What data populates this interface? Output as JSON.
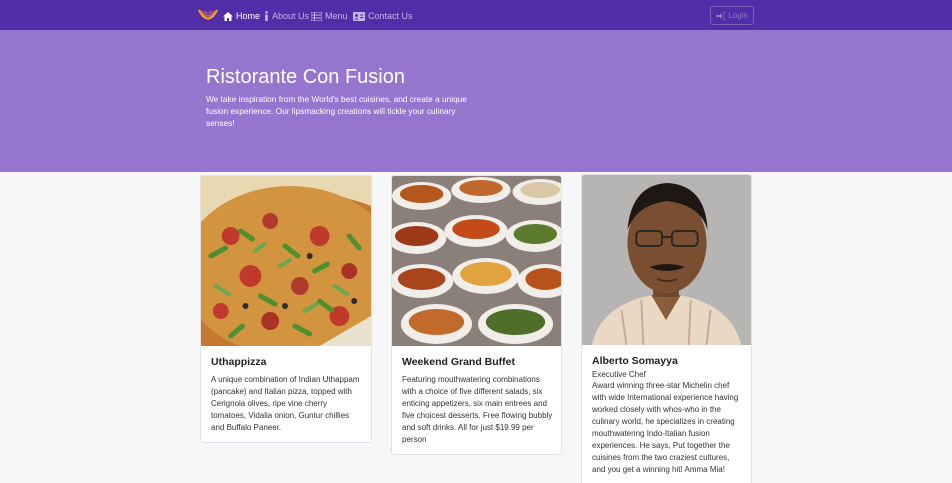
{
  "navbar": {
    "logo": "restaurant-logo",
    "links": [
      {
        "label": "Home",
        "icon": "home-icon",
        "active": true
      },
      {
        "label": "About Us",
        "icon": "info-icon",
        "active": false
      },
      {
        "label": "Menu",
        "icon": "list-icon",
        "active": false
      },
      {
        "label": "Contact Us",
        "icon": "address-card-icon",
        "active": false
      }
    ],
    "login_label": "Login"
  },
  "jumbotron": {
    "title": "Ristorante Con Fusion",
    "text": "We take inspiration from the World's best cuisines, and create a unique fusion experience. Our lipsmacking creations will tickle your culinary senses!"
  },
  "cards": [
    {
      "image": "pizza-photo",
      "title": "Uthappizza",
      "subtitle": "",
      "text": "A unique combination of Indian Uthappam (pancake) and Italian pizza, topped with Cerignola olives, ripe vine cherry tomatoes, Vidalia onion, Guntur chillies and Buffalo Paneer."
    },
    {
      "image": "buffet-photo",
      "title": "Weekend Grand Buffet",
      "subtitle": "",
      "text": "Featuring mouthwatering combinations with a choice of five different salads, six enticing appetizers, six main entrees and five choicest desserts. Free flowing bubbly and soft drinks. All for just $19.99 per person"
    },
    {
      "image": "chef-photo",
      "title": "Alberto Somayya",
      "subtitle": "Executive Chef",
      "text": "Award winning three-star Michelin chef with wide International experience having worked closely with whos-who in the culinary world, he specializes in creating mouthwatering Indo-Italian fusion experiences. He says, Put together the cuisines from the two craziest cultures, and you get a winning hit! Amma Mia!"
    }
  ],
  "colors": {
    "navbar": "#512da8",
    "jumbotron": "#9575cd",
    "background": "#f7f6f8"
  }
}
